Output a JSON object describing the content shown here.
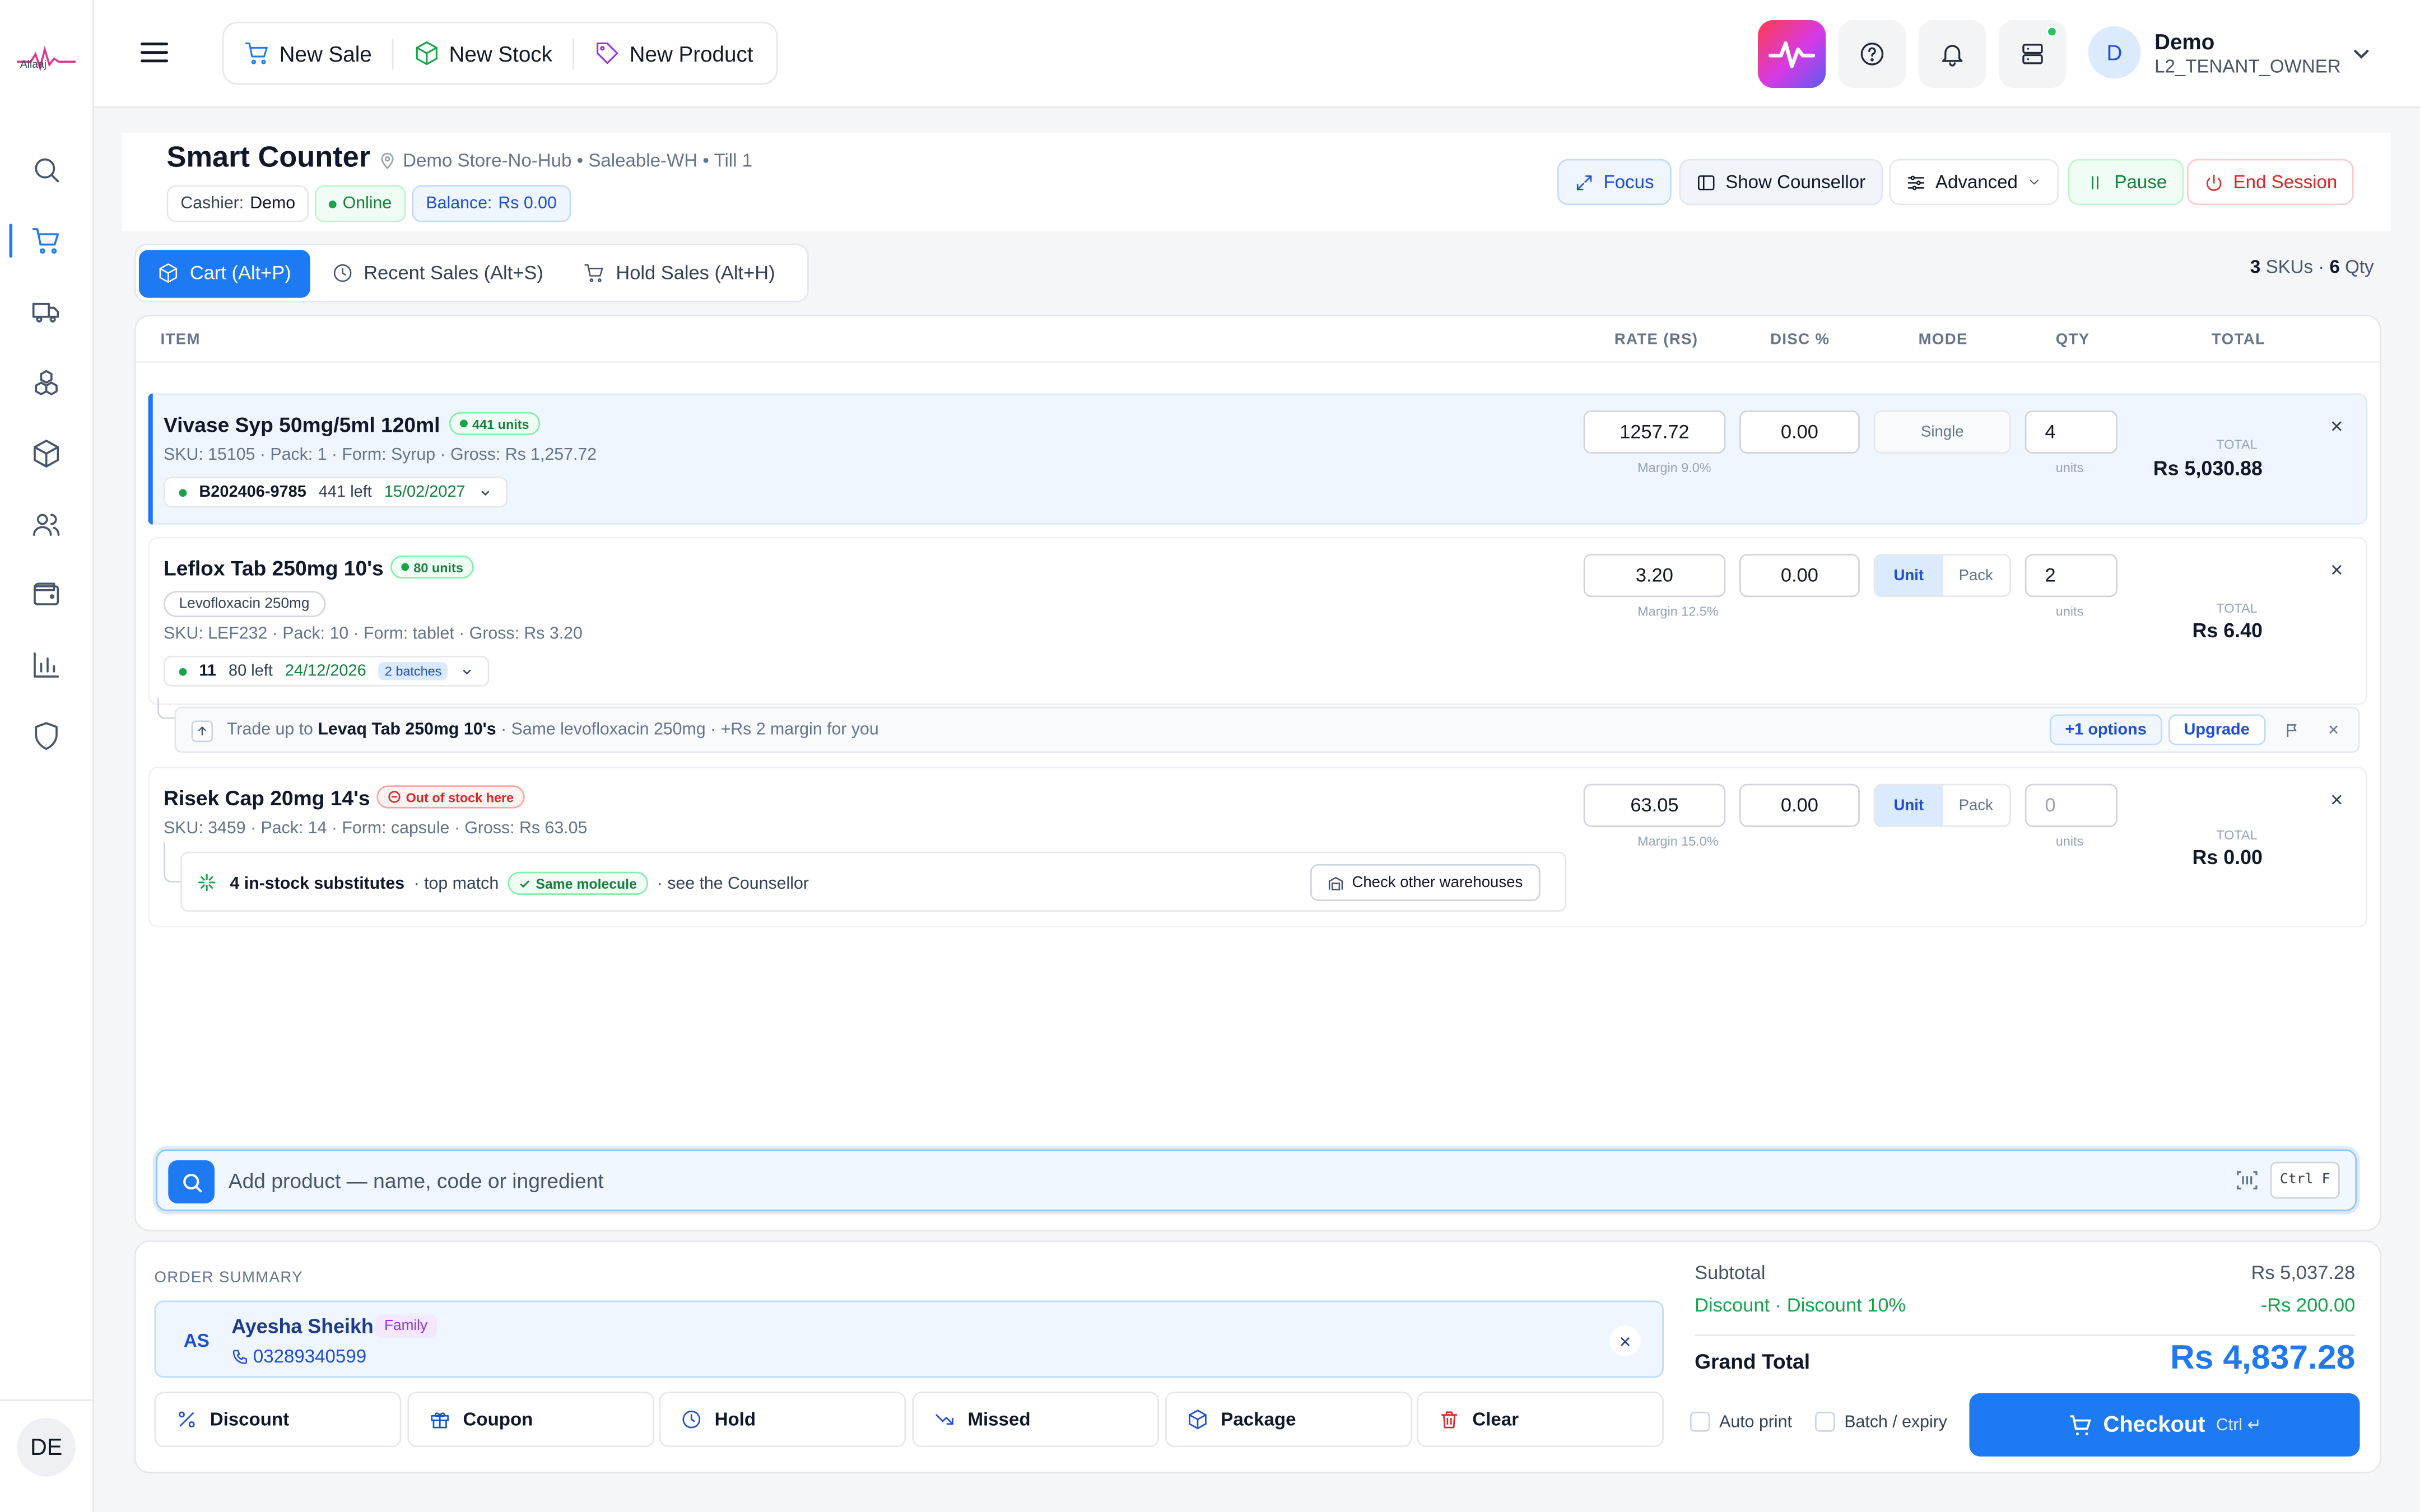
{
  "app": {
    "logo_text": "Ailaaj"
  },
  "sidebar": {
    "items": [
      "search",
      "cart",
      "delivery",
      "boxes",
      "package",
      "users",
      "wallet",
      "reports",
      "shield"
    ],
    "avatar": "DE"
  },
  "topbar": {
    "quick_actions": [
      {
        "label": "New Sale"
      },
      {
        "label": "New Stock"
      },
      {
        "label": "New Product"
      }
    ],
    "user": {
      "initial": "D",
      "name": "Demo",
      "role": "L2_TENANT_OWNER"
    }
  },
  "header": {
    "title": "Smart Counter",
    "location": "Demo Store-No-Hub • Saleable-WH • Till 1",
    "cashier_label": "Cashier:",
    "cashier_value": "Demo",
    "status": "Online",
    "balance_label": "Balance:",
    "balance_value": "Rs 0.00",
    "buttons": {
      "focus": "Focus",
      "counsellor": "Show Counsellor",
      "advanced": "Advanced",
      "pause": "Pause",
      "end": "End Session"
    }
  },
  "tabs": [
    {
      "label": "Cart (Alt+P)",
      "active": true
    },
    {
      "label": "Recent Sales (Alt+S)",
      "active": false
    },
    {
      "label": "Hold Sales (Alt+H)",
      "active": false
    }
  ],
  "cart_summary": {
    "skus": "3",
    "skus_label": "SKUs ·",
    "qty": "6",
    "qty_label": "Qty"
  },
  "columns": {
    "item": "ITEM",
    "rate": "RATE (RS)",
    "disc": "DISC %",
    "mode": "MODE",
    "qty": "QTY",
    "total": "TOTAL"
  },
  "items": [
    {
      "name": "Vivase Syp 50mg/5ml 120ml",
      "stock_chip": "441 units",
      "meta": "SKU: 15105 · Pack: 1 · Form: Syrup · Gross: Rs 1,257.72",
      "batch_id": "B202406-9785",
      "batch_left": "441 left",
      "batch_expiry": "15/02/2027",
      "rate": "1257.72",
      "margin": "Margin 9.0%",
      "disc": "0.00",
      "mode": "Single",
      "qty": "4",
      "qty_unit": "units",
      "total_label": "TOTAL",
      "total": "Rs 5,030.88"
    },
    {
      "name": "Leflox Tab 250mg 10's",
      "stock_chip": "80 units",
      "generic": "Levofloxacin 250mg",
      "meta": "SKU: LEF232 · Pack: 10 · Form: tablet · Gross: Rs 3.20",
      "batch_id": "11",
      "batch_left": "80 left",
      "batch_expiry": "24/12/2026",
      "batch_count": "2 batches",
      "rate": "3.20",
      "margin": "Margin 12.5%",
      "disc": "0.00",
      "mode_unit": "Unit",
      "mode_pack": "Pack",
      "qty": "2",
      "qty_unit": "units",
      "total_label": "TOTAL",
      "total": "Rs 6.40"
    },
    {
      "name": "Risek Cap 20mg 14's",
      "stock_chip": "Out of stock here",
      "meta": "SKU: 3459 · Pack: 14 · Form: capsule · Gross: Rs 63.05",
      "rate": "63.05",
      "margin": "Margin 15.0%",
      "disc": "0.00",
      "mode_unit": "Unit",
      "mode_pack": "Pack",
      "qty": "0",
      "qty_unit": "units",
      "total_label": "TOTAL",
      "total": "Rs 0.00"
    }
  ],
  "upsell": {
    "prefix": "Trade up to",
    "product": "Levaq Tab 250mg 10's",
    "suffix": "· Same levofloxacin 250mg · +Rs 2 margin for you",
    "options": "+1 options",
    "upgrade": "Upgrade"
  },
  "substitutes": {
    "count_text": "4 in-stock substitutes",
    "top_match": "· top match",
    "chip": "Same molecule",
    "see": "· see the Counsellor",
    "button": "Check other warehouses"
  },
  "search": {
    "placeholder": "Add product — name, code or ingredient",
    "shortcut": "Ctrl F"
  },
  "order_summary": {
    "title": "ORDER SUMMARY",
    "customer": {
      "initials": "AS",
      "name": "Ayesha Sheikh",
      "tag": "Family",
      "phone": "03289340599"
    },
    "actions": [
      "Discount",
      "Coupon",
      "Hold",
      "Missed",
      "Package",
      "Clear"
    ],
    "subtotal_label": "Subtotal",
    "subtotal": "Rs 5,037.28",
    "discount_label": "Discount · Discount 10%",
    "discount": "-Rs 200.00",
    "grand_label": "Grand Total",
    "grand": "Rs 4,837.28",
    "auto_print": "Auto print",
    "batch_expiry": "Batch / expiry",
    "checkout": "Checkout",
    "checkout_shortcut": "Ctrl ↵"
  },
  "colors": {
    "accent": "#1d7af3",
    "success": "#15803d",
    "danger": "#dc2626",
    "purple": "#9333ea"
  }
}
